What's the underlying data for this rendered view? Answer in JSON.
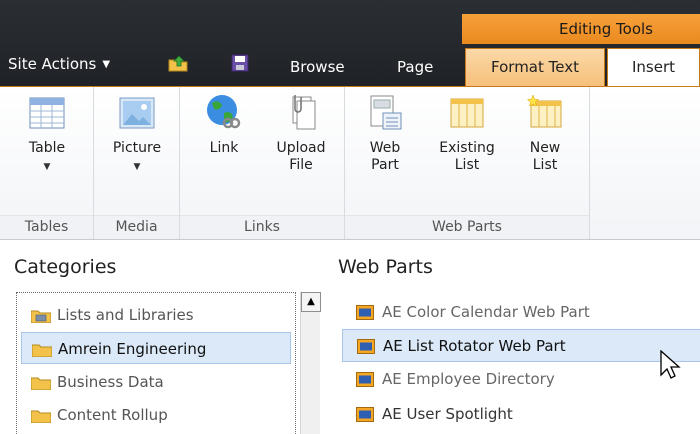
{
  "contextual_group": {
    "label": "Editing Tools"
  },
  "tabs": {
    "site_actions": "Site Actions",
    "browse": "Browse",
    "page": "Page",
    "format_text": "Format Text",
    "insert": "Insert"
  },
  "ribbon": {
    "tables": {
      "label": "Tables",
      "table_btn": "Table"
    },
    "media": {
      "label": "Media",
      "picture_btn": "Picture"
    },
    "links": {
      "label": "Links",
      "link_btn": "Link",
      "upload_line1": "Upload",
      "upload_line2": "File"
    },
    "web_parts": {
      "label": "Web Parts",
      "web_part_line1": "Web",
      "web_part_line2": "Part",
      "existing_line1": "Existing",
      "existing_line2": "List",
      "new_line1": "New",
      "new_line2": "List"
    }
  },
  "categories": {
    "title": "Categories",
    "items": [
      "Lists and Libraries",
      "Amrein Engineering",
      "Business Data",
      "Content Rollup"
    ]
  },
  "web_parts_list": {
    "title": "Web Parts",
    "items": [
      "AE Color Calendar Web Part",
      "AE List Rotator Web Part",
      "AE Employee Directory",
      "AE User Spotlight"
    ]
  },
  "colors": {
    "accent": "#f39a2c",
    "selection": "#dbe9f8",
    "topbar": "#2b2e33"
  }
}
